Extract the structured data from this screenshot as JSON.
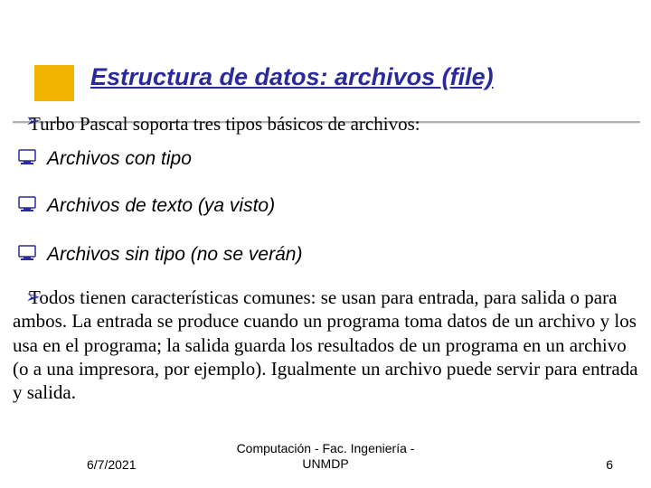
{
  "title": "Estructura de datos: archivos (file)",
  "intro": "Turbo Pascal soporta tres tipos básicos de archivos:",
  "items": [
    {
      "label": "Archivos con tipo"
    },
    {
      "label": "Archivos de texto (ya visto)"
    },
    {
      "label": "Archivos sin tipo (no se verán)"
    }
  ],
  "paragraph": "Todos tienen características comunes:  se usan para entrada, para salida o para ambos. La entrada se produce cuando un programa toma datos de un archivo y los usa en el programa; la salida guarda los resultados de un programa en un archivo (o a una impresora, por ejemplo). Igualmente un archivo puede servir para entrada y salida.",
  "footer": {
    "date": "6/7/2021",
    "center": "Computación - Fac. Ingeniería - UNMDP",
    "page": "6"
  },
  "bullets": {
    "arrow": "➢"
  }
}
